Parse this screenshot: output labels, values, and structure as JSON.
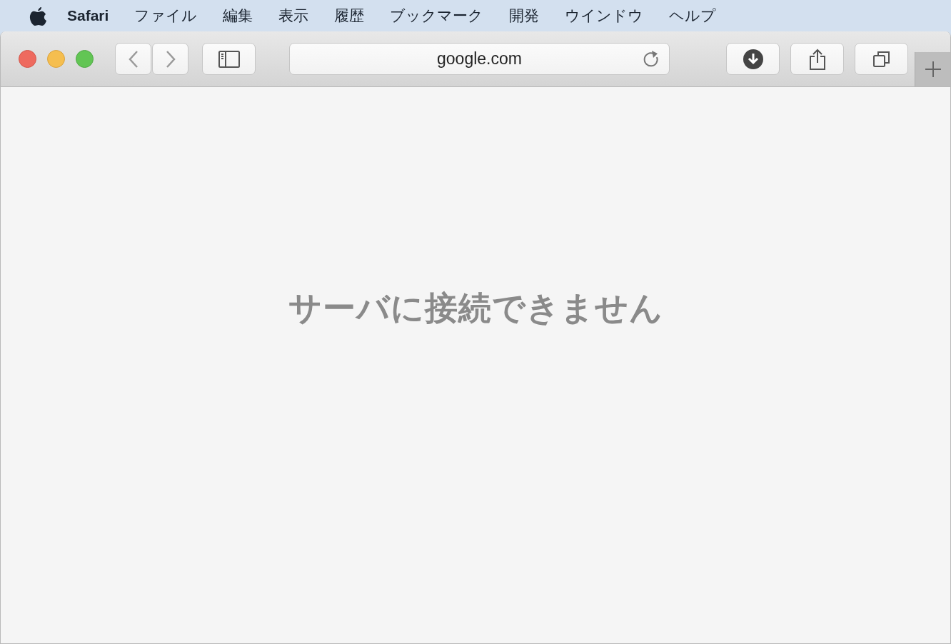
{
  "menu_bar": {
    "app_name": "Safari",
    "items": [
      "ファイル",
      "編集",
      "表示",
      "履歴",
      "ブックマーク",
      "開発",
      "ウインドウ",
      "ヘルプ"
    ]
  },
  "toolbar": {
    "address": "google.com"
  },
  "page": {
    "message": "サーバに接続できません"
  }
}
